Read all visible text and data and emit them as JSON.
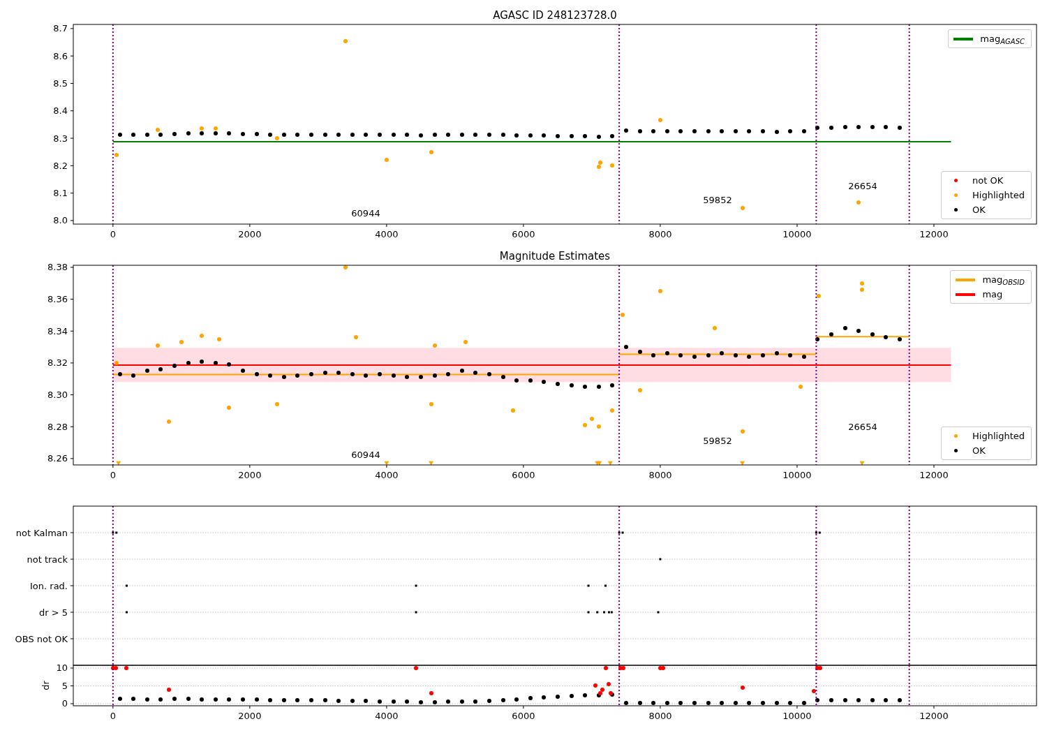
{
  "figure": {
    "charts": [
      {
        "chart_data": {
          "type": "scatter",
          "title": "AGASC ID 248123728.0",
          "xlim": [
            -580,
            13500
          ],
          "ylim": [
            7.987,
            8.715
          ],
          "xticks": [
            0,
            2000,
            4000,
            6000,
            8000,
            10000,
            12000
          ],
          "yticks": [
            {
              "value": 8.0,
              "label": "8.0"
            },
            {
              "value": 8.1,
              "label": "8.1"
            },
            {
              "value": 8.2,
              "label": "8.2"
            },
            {
              "value": 8.3,
              "label": "8.3"
            },
            {
              "value": 8.4,
              "label": "8.4"
            },
            {
              "value": 8.5,
              "label": "8.5"
            },
            {
              "value": 8.6,
              "label": "8.6"
            },
            {
              "value": 8.7,
              "label": "8.7"
            }
          ],
          "series": [
            {
              "name": "mag$_{AGASC}$",
              "type": "line",
              "color": "#008000",
              "x": [
                0,
                12250
              ],
              "values": [
                8.287,
                8.287
              ]
            },
            {
              "name": "not OK",
              "type": "scatter",
              "color": "#ff0000"
            },
            {
              "name": "Highlighted",
              "type": "scatter",
              "color": "#ffa500",
              "x": [
                50,
                650,
                1300,
                1500,
                2400,
                3400,
                4000,
                4650,
                7100,
                7120,
                7300,
                8000,
                9200,
                10900
              ],
              "values": [
                8.24,
                8.33,
                8.335,
                8.335,
                8.3,
                8.655,
                8.22,
                8.25,
                8.195,
                8.21,
                8.2,
                8.365,
                8.045,
                8.065
              ]
            },
            {
              "name": "OK",
              "type": "scatter",
              "color": "#000000",
              "x": [
                100,
                300,
                500,
                700,
                900,
                1100,
                1300,
                1500,
                1700,
                1900,
                2100,
                2300,
                2500,
                2700,
                2900,
                3100,
                3300,
                3500,
                3700,
                3900,
                4100,
                4300,
                4500,
                4700,
                4900,
                5100,
                5300,
                5500,
                5700,
                5900,
                6100,
                6300,
                6500,
                6700,
                6900,
                7100,
                7300,
                7500,
                7700,
                7900,
                8100,
                8300,
                8500,
                8700,
                8900,
                9100,
                9300,
                9500,
                9700,
                9900,
                10100,
                10300,
                10500,
                10700,
                10900,
                11100,
                11300,
                11500
              ],
              "values": [
                8.313,
                8.312,
                8.313,
                8.314,
                8.315,
                8.318,
                8.319,
                8.318,
                8.317,
                8.316,
                8.315,
                8.314,
                8.313,
                8.313,
                8.312,
                8.313,
                8.314,
                8.314,
                8.313,
                8.313,
                8.312,
                8.312,
                8.311,
                8.312,
                8.313,
                8.314,
                8.314,
                8.313,
                8.312,
                8.311,
                8.311,
                8.31,
                8.309,
                8.308,
                8.307,
                8.306,
                8.307,
                8.327,
                8.326,
                8.326,
                8.325,
                8.326,
                8.325,
                8.325,
                8.326,
                8.326,
                8.325,
                8.325,
                8.324,
                8.325,
                8.325,
                8.338,
                8.339,
                8.342,
                8.342,
                8.341,
                8.34,
                8.338
              ]
            }
          ],
          "ref_lines": [
            {
              "axis": "x",
              "value": 0
            },
            {
              "axis": "x",
              "value": 7400
            },
            {
              "axis": "x",
              "value": 10280
            },
            {
              "axis": "x",
              "value": 11640
            }
          ],
          "annotations": [
            "60944",
            "59852",
            "26654"
          ]
        }
      },
      {
        "chart_data": {
          "type": "scatter",
          "title": "Magnitude Estimates",
          "xlim": [
            -580,
            13500
          ],
          "ylim": [
            8.256,
            8.3813
          ],
          "xticks": [
            0,
            2000,
            4000,
            6000,
            8000,
            10000,
            12000
          ],
          "yticks": [
            {
              "value": 8.26,
              "label": "8.26"
            },
            {
              "value": 8.28,
              "label": "8.28"
            },
            {
              "value": 8.3,
              "label": "8.30"
            },
            {
              "value": 8.32,
              "label": "8.32"
            },
            {
              "value": 8.34,
              "label": "8.34"
            },
            {
              "value": 8.36,
              "label": "8.36"
            },
            {
              "value": 8.38,
              "label": "8.38"
            }
          ],
          "series": [
            {
              "name": "mag$_{OBSID}$",
              "type": "line",
              "color": "#ffa500",
              "x": [
                0,
                7400
              ],
              "values": [
                8.3128,
                8.3128
              ]
            },
            {
              "type": "line",
              "color": "#ffa500",
              "x": [
                7400,
                10280
              ],
              "values": [
                8.3255,
                8.3255
              ]
            },
            {
              "type": "line",
              "color": "#ffa500",
              "x": [
                10280,
                11640
              ],
              "values": [
                8.3365,
                8.3365
              ]
            },
            {
              "name": "mag",
              "type": "line",
              "color": "#ff0000",
              "x": [
                0,
                12250
              ],
              "values": [
                8.3187,
                8.3187
              ]
            },
            {
              "name": "Highlighted",
              "type": "scatter",
              "color": "#ffa500",
              "x": [
                50,
                650,
                820,
                1000,
                1300,
                1550,
                1700,
                2400,
                3400,
                3550,
                4650,
                4700,
                5150,
                5850,
                6900,
                7000,
                7100,
                7300,
                7450,
                7700,
                8000,
                8800,
                9200,
                10050,
                10320,
                10950,
                10950
              ],
              "values": [
                8.32,
                8.331,
                8.283,
                8.333,
                8.337,
                8.335,
                8.292,
                8.294,
                8.38,
                8.336,
                8.294,
                8.331,
                8.333,
                8.29,
                8.281,
                8.285,
                8.28,
                8.29,
                8.35,
                8.303,
                8.365,
                8.342,
                8.277,
                8.305,
                8.362,
                8.37,
                8.366
              ]
            },
            {
              "type": "scatter",
              "color": "#ffa500",
              "x": [
                80,
                4000,
                4650,
                7080,
                7110,
                7270,
                9200,
                10950
              ],
              "values": [
                8.257,
                8.257,
                8.257,
                8.257,
                8.257,
                8.257,
                8.257,
                8.257
              ]
            },
            {
              "name": "OK",
              "type": "scatter",
              "color": "#000000",
              "x": [
                100,
                300,
                500,
                700,
                900,
                1100,
                1300,
                1500,
                1700,
                1900,
                2100,
                2300,
                2500,
                2700,
                2900,
                3100,
                3300,
                3500,
                3700,
                3900,
                4100,
                4300,
                4500,
                4700,
                4900,
                5100,
                5300,
                5500,
                5700,
                5900,
                6100,
                6300,
                6500,
                6700,
                6900,
                7100,
                7300,
                7500,
                7700,
                7900,
                8100,
                8300,
                8500,
                8700,
                8900,
                9100,
                9300,
                9500,
                9700,
                9900,
                10100,
                10300,
                10500,
                10700,
                10900,
                11100,
                11300,
                11500
              ],
              "values": [
                8.313,
                8.312,
                8.315,
                8.316,
                8.318,
                8.32,
                8.321,
                8.32,
                8.319,
                8.315,
                8.313,
                8.312,
                8.311,
                8.312,
                8.313,
                8.314,
                8.314,
                8.313,
                8.312,
                8.313,
                8.312,
                8.311,
                8.311,
                8.312,
                8.313,
                8.315,
                8.314,
                8.313,
                8.311,
                8.309,
                8.309,
                8.308,
                8.307,
                8.306,
                8.305,
                8.305,
                8.306,
                8.33,
                8.327,
                8.325,
                8.326,
                8.325,
                8.324,
                8.325,
                8.326,
                8.325,
                8.324,
                8.325,
                8.326,
                8.325,
                8.324,
                8.335,
                8.338,
                8.342,
                8.34,
                8.338,
                8.336,
                8.335
              ]
            }
          ],
          "bands": [
            {
              "axis": "y",
              "from": 8.308,
              "to": 8.3295
            }
          ],
          "ref_lines": [
            {
              "axis": "x",
              "value": 0
            },
            {
              "axis": "x",
              "value": 7400
            },
            {
              "axis": "x",
              "value": 10280
            },
            {
              "axis": "x",
              "value": 11640
            }
          ],
          "annotations": [
            "60944",
            "59852",
            "26654"
          ]
        }
      },
      {
        "flags_panel": {
          "rows": [
            "not Kalman",
            "not track",
            "Ion. rad.",
            "dr > 5",
            "OBS not OK"
          ]
        }
      },
      {
        "chart_data": {
          "type": "scatter",
          "ylabel": "dr",
          "grid": true,
          "xlim": [
            -580,
            13500
          ],
          "ylim": [
            -0.59,
            10.78
          ],
          "xticks": [
            0,
            2000,
            4000,
            6000,
            8000,
            10000,
            12000
          ],
          "yticks": [
            0,
            5,
            10
          ],
          "series": [
            {
              "type": "scatter",
              "color": "#000000",
              "x": [
                100,
                300,
                500,
                700,
                900,
                1100,
                1300,
                1500,
                1700,
                1900,
                2100,
                2300,
                2500,
                2700,
                2900,
                3100,
                3300,
                3500,
                3700,
                3900,
                4100,
                4300,
                4500,
                4700,
                4900,
                5100,
                5300,
                5500,
                5700,
                5900,
                6100,
                6300,
                6500,
                6700,
                6900,
                7100,
                7300,
                7500,
                7700,
                7900,
                8100,
                8300,
                8500,
                8700,
                8900,
                9100,
                9300,
                9500,
                9700,
                9900,
                10100,
                10300,
                10500,
                10700,
                10900,
                11100,
                11300,
                11500
              ],
              "values": [
                1.3,
                1.3,
                1.2,
                1.2,
                1.3,
                1.3,
                1.2,
                1.2,
                1.1,
                1.1,
                1.1,
                1.0,
                1.0,
                1.0,
                0.9,
                0.9,
                0.8,
                0.8,
                0.7,
                0.6,
                0.5,
                0.5,
                0.4,
                0.4,
                0.5,
                0.5,
                0.6,
                0.8,
                0.9,
                1.2,
                1.5,
                1.7,
                1.9,
                2.2,
                2.4,
                2.3,
                2.5,
                0.1,
                0.1,
                0.1,
                0.1,
                0.1,
                0.1,
                0.1,
                0.1,
                0.1,
                0.1,
                0.1,
                0.1,
                0.1,
                0.1,
                1.0,
                0.9,
                1.0,
                0.9,
                1.0,
                0.9,
                1.0
              ]
            },
            {
              "type": "scatter",
              "color": "#ff0000",
              "x": [
                0,
                40,
                200,
                820,
                4430,
                4650,
                7050,
                7120,
                7150,
                7200,
                7250,
                7280,
                7420,
                7460,
                8000,
                8040,
                9200,
                10250,
                10300,
                10340
              ],
              "values": [
                10,
                10,
                10,
                4,
                10,
                3,
                5,
                3,
                4,
                10,
                5.5,
                3,
                10,
                10,
                10,
                10,
                4.5,
                3.5,
                10,
                10
              ]
            }
          ],
          "ref_lines": [
            {
              "axis": "x",
              "value": 0
            },
            {
              "axis": "x",
              "value": 7400
            },
            {
              "axis": "x",
              "value": 10280
            },
            {
              "axis": "x",
              "value": 11640
            }
          ]
        }
      }
    ]
  }
}
